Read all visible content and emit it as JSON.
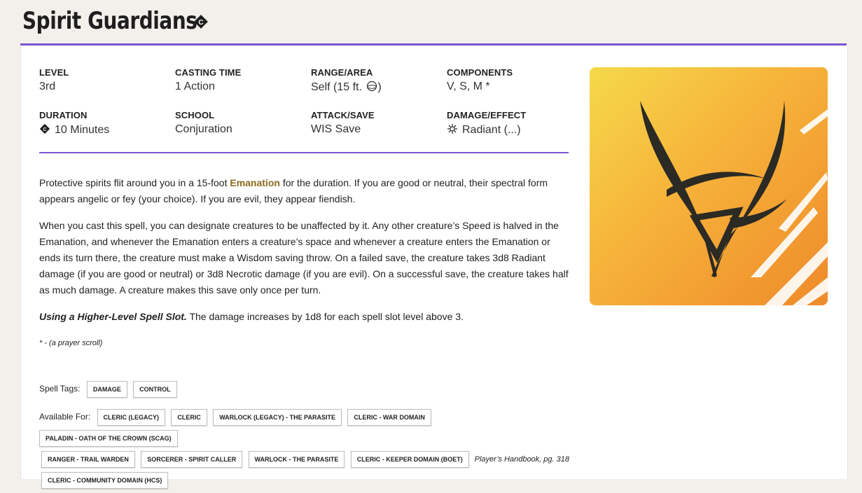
{
  "spell": {
    "name": "Spirit Guardians",
    "stats": {
      "level_label": "LEVEL",
      "level": "3rd",
      "casting_label": "CASTING TIME",
      "casting": "1 Action",
      "range_label": "RANGE/AREA",
      "range": "Self (15 ft. ",
      "range_close": ")",
      "components_label": "COMPONENTS",
      "components": "V, S, M *",
      "duration_label": "DURATION",
      "duration": "10 Minutes",
      "school_label": "SCHOOL",
      "school": "Conjuration",
      "attack_label": "ATTACK/SAVE",
      "attack": "WIS Save",
      "damage_label": "DAMAGE/EFFECT",
      "damage": "Radiant (...)"
    },
    "description": {
      "p1_a": "Protective spirits flit around you in a 15-foot ",
      "p1_link": "Emanation",
      "p1_b": " for the duration. If you are good or neutral, their spectral form appears angelic or fey (your choice). If you are evil, they appear fiendish.",
      "p2": "When you cast this spell, you can designate creatures to be unaffected by it. Any other creature’s Speed is halved in the Emanation, and whenever the Emanation enters a creature’s space and whenever a creature enters the Emanation or ends its turn there, the creature must make a Wisdom saving throw. On a failed save, the creature takes 3d8 Radiant damage (if you are good or neutral) or 3d8 Necrotic damage (if you are evil). On a successful save, the creature takes half as much damage. A creature makes this save only once per turn.",
      "p3_bold": "Using a Higher-Level Spell Slot.",
      "p3": " The damage increases by 1d8 for each spell slot level above 3.",
      "footnote": "* - (a prayer scroll)"
    },
    "tags_label": "Spell Tags:",
    "tags": [
      "DAMAGE",
      "CONTROL"
    ],
    "available_label": "Available For:",
    "available": [
      "CLERIC (LEGACY)",
      "CLERIC",
      "WARLOCK (LEGACY) - THE PARASITE",
      "CLERIC - WAR DOMAIN",
      "PALADIN - OATH OF THE CROWN (SCAG)",
      "RANGER - TRAIL WARDEN",
      "SORCERER - SPIRIT CALLER",
      "WARLOCK - THE PARASITE",
      "CLERIC - KEEPER DOMAIN (BOET)",
      "CLERIC - COMMUNITY DOMAIN (HCS)"
    ],
    "source": "Player’s Handbook, pg. 318"
  },
  "colors": {
    "accent": "#7b55d1",
    "link": "#8b6a1a"
  },
  "icons": {
    "title": "concentration-icon",
    "range": "sphere-icon",
    "duration": "concentration-icon",
    "damage": "radiant-icon"
  }
}
